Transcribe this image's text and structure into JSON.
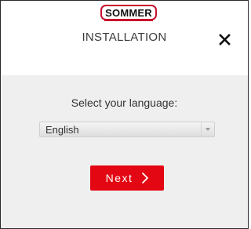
{
  "header": {
    "logo_text": "SOMMER",
    "title": "INSTALLATION",
    "close_icon": "close-icon"
  },
  "main": {
    "prompt": "Select your language:",
    "language_select": {
      "value": "English",
      "icon": "chevron-down-icon"
    },
    "next_button": {
      "label": "Next",
      "icon": "chevron-right-icon"
    }
  },
  "colors": {
    "brand_red": "#e30613",
    "logo_border": "#c8102e",
    "panel_background": "#efefef"
  }
}
